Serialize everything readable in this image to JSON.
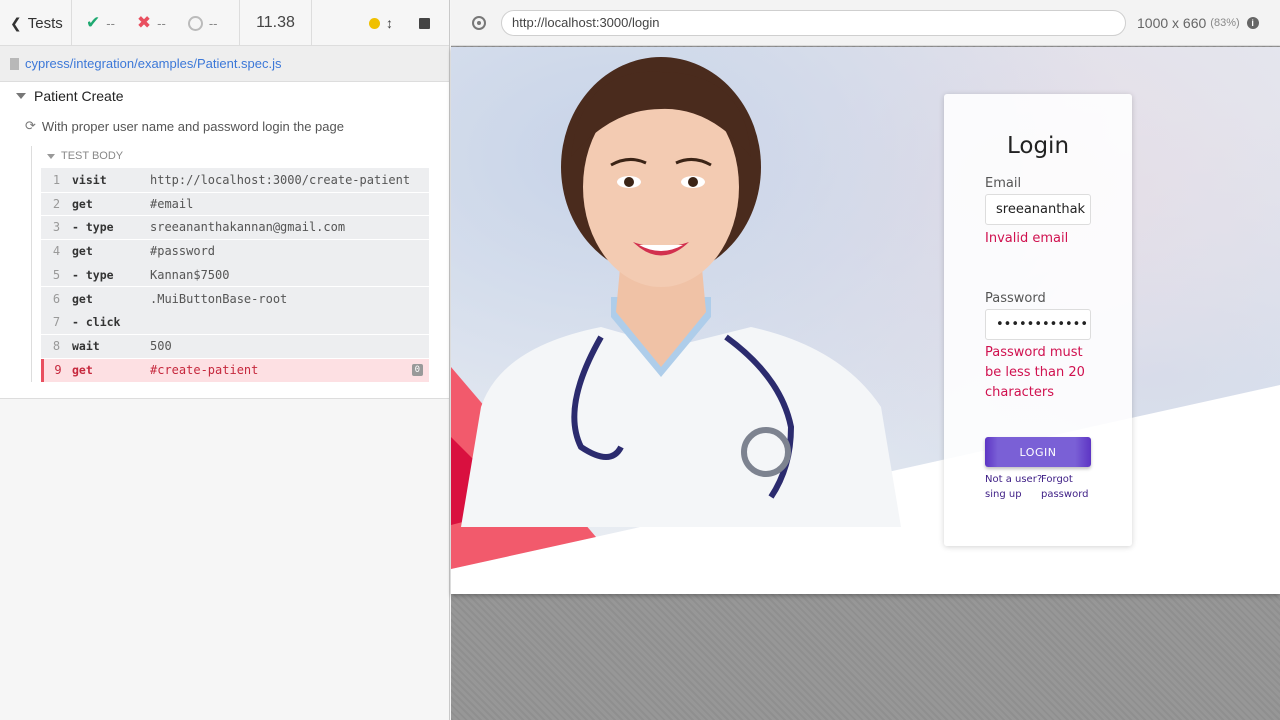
{
  "reporter": {
    "tests_label": "Tests",
    "passed": "--",
    "failed": "--",
    "pending": "--",
    "duration": "11.38",
    "spec_path": "cypress/integration/examples/Patient.spec.js",
    "suite_title": "Patient Create",
    "test_title": "With proper user name and password login the page",
    "body_label": "TEST BODY",
    "commands": [
      {
        "num": "1",
        "name": "visit",
        "msg": "http://localhost:3000/create-patient"
      },
      {
        "num": "2",
        "name": "get",
        "msg": "#email"
      },
      {
        "num": "3",
        "name": " - type",
        "msg": "sreeananthakannan@gmail.com"
      },
      {
        "num": "4",
        "name": "get",
        "msg": "#password"
      },
      {
        "num": "5",
        "name": " - type",
        "msg": "Kannan$7500"
      },
      {
        "num": "6",
        "name": "get",
        "msg": ".MuiButtonBase-root"
      },
      {
        "num": "7",
        "name": " - click",
        "msg": ""
      },
      {
        "num": "8",
        "name": "wait",
        "msg": "500"
      },
      {
        "num": "9",
        "name": "get",
        "msg": "#create-patient",
        "badge": "0"
      }
    ]
  },
  "aut": {
    "url": "http://localhost:3000/login",
    "viewport": "1000 x 660",
    "scale": "(83%)",
    "info": "i"
  },
  "login": {
    "title": "Login",
    "email_label": "Email",
    "email_value": "sreeananthak",
    "email_error": "Invalid email",
    "password_label": "Password",
    "password_value": "••••••••••••••",
    "password_error": "Password must be less than 20 characters",
    "button": "LOGIN",
    "signup_link": "Not a user? sing up",
    "forgot_link": "Forgot password"
  },
  "colors": {
    "pass": "#1fa971",
    "fail": "#e94f5f",
    "error_text": "#d0114f",
    "button": "#7a60d6"
  }
}
